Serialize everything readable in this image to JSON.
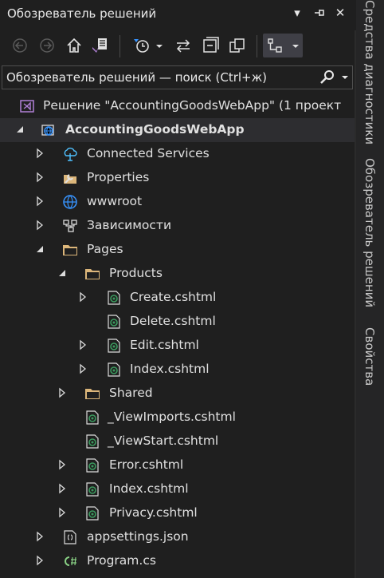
{
  "panel": {
    "title": "Обозреватель решений",
    "window_buttons": {
      "dropdown": "▾",
      "pin": "⊣",
      "close": "✕"
    }
  },
  "toolbar": {
    "buttons": [
      "back-icon",
      "forward-icon",
      "home-icon",
      "switch-views-icon",
      "pending-changes-icon",
      "sync-icon",
      "collapse-all-icon",
      "show-all-files-icon",
      "properties-filter-icon"
    ]
  },
  "search": {
    "placeholder": "Обозреватель решений — поиск (Ctrl+ж)"
  },
  "tree": {
    "solution": "Решение \"AccountingGoodsWebApp\"  (1 проект",
    "project": "AccountingGoodsWebApp",
    "items": [
      {
        "label": "Connected Services"
      },
      {
        "label": "Properties"
      },
      {
        "label": "wwwroot"
      },
      {
        "label": "Зависимости"
      },
      {
        "label": "Pages"
      },
      {
        "label": "Products"
      },
      {
        "label": "Create.cshtml"
      },
      {
        "label": "Delete.cshtml"
      },
      {
        "label": "Edit.cshtml"
      },
      {
        "label": "Index.cshtml"
      },
      {
        "label": "Shared"
      },
      {
        "label": "_ViewImports.cshtml"
      },
      {
        "label": "_ViewStart.cshtml"
      },
      {
        "label": "Error.cshtml"
      },
      {
        "label": "Index.cshtml"
      },
      {
        "label": "Privacy.cshtml"
      },
      {
        "label": "appsettings.json"
      },
      {
        "label": "Program.cs"
      }
    ]
  },
  "side_tabs": [
    "Средства диагностики",
    "Обозреватель решений",
    "Свойства"
  ],
  "colors": {
    "background": "#1f1f1f",
    "folder": "#dcb67a",
    "razor": "#3c9a5f",
    "vs_purple": "#b180d7",
    "globe": "#3794ff"
  }
}
